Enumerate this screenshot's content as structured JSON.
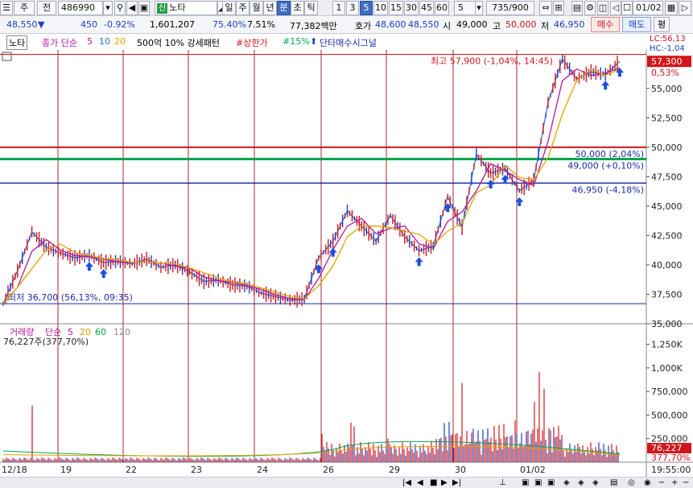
{
  "toolbar": {
    "period_main": "주",
    "compare_btn": "전",
    "stock_code": "486990",
    "credit_tag": "신",
    "stock_name": "노타",
    "period_tabs": [
      "일",
      "주",
      "월",
      "년",
      "분",
      "초",
      "틱"
    ],
    "active_period": "분",
    "intervals": [
      "1",
      "3",
      "5",
      "10",
      "15",
      "30",
      "45",
      "60"
    ],
    "active_interval": "5",
    "interval_select": "5",
    "page_counter": "735/900",
    "date_field": "01/02"
  },
  "quote": {
    "price": "48,550",
    "change_arrow": "▼",
    "change": "450",
    "change_pct": "-0.92%",
    "volume": "1,601,207",
    "vol_ratio": "75.40%",
    "turnover_ratio": "7.51%",
    "amount": "77,382백만",
    "bid_label": "호가",
    "bid": "48,600",
    "ask": "48,550",
    "open_label": "시",
    "open": "49,000",
    "high_label": "고",
    "high": "50,000",
    "low_label": "저",
    "low": "46,950",
    "buy_button": "매수",
    "sell_button": "매도",
    "eval_button": "평"
  },
  "legend": {
    "name": "노타",
    "ma_label": "종가 단순",
    "ma_periods": [
      "5",
      "10",
      "20"
    ],
    "pattern_label": "500억 10% 강세패턴",
    "upper_limit": "#상한가",
    "pct15": "#15%",
    "signal": "단타매수시그널",
    "lc": "LC:56,13",
    "hc": "HC:-1,04"
  },
  "price_axis": {
    "ticks": [
      "55,000",
      "52,500",
      "50,000",
      "47,500",
      "45,000",
      "42,500",
      "40,000",
      "37,500",
      "35,000"
    ],
    "current_price_box": "57,300",
    "current_pct": "0,53%"
  },
  "annotations": {
    "high_label": "최고 57,900 (-1,04%, 14:45)",
    "low_label": "최저 36,700 (56,13%, 09:35)",
    "line_50000": "50,000 (2,04%)",
    "line_49000": "49,000 (+0,10%)",
    "line_46950": "46,950 (-4,18%)"
  },
  "volume_legend": {
    "label": "거래량",
    "ma_label": "단순",
    "periods": [
      "5",
      "20",
      "60",
      "120"
    ],
    "current": "76,227주(377,70%)"
  },
  "volume_axis": {
    "ticks": [
      "1,250K",
      "1,000K",
      "750,000",
      "500,000",
      "250,000"
    ],
    "current_box": "76,227",
    "current_pct": "377,70%"
  },
  "date_axis": {
    "labels": [
      "12/18",
      "19",
      "22",
      "23",
      "24",
      "26",
      "29",
      "30",
      "01/02"
    ],
    "time_label": "19:55:00"
  },
  "colors": {
    "candle_up": "#d0161c",
    "candle_down": "#1b3fc4",
    "ma5": "#b5179e",
    "ma10": "#2c6fd6",
    "ma20": "#e0a400",
    "line_50000": "#d0161c",
    "line_49000": "#00a650",
    "line_46950": "#1b2aa8",
    "signal_arrow": "#1f4fe0",
    "day_separator": "#a52a2a"
  },
  "chart_data": {
    "type": "line",
    "series": [
      {
        "values": [
          36700,
          39500,
          42800,
          41500,
          41000,
          40600,
          40800,
          40200,
          40300,
          40100,
          40500,
          39800,
          40000,
          39400,
          38600,
          38700,
          38300,
          38200,
          37600,
          37300,
          37000,
          37100,
          40600,
          42000,
          44600,
          43300,
          42000,
          44200,
          42400,
          41200,
          41600,
          45800,
          43200,
          49400,
          47800,
          48200,
          46300,
          47200,
          53800,
          57500,
          55800,
          56400,
          56200,
          57300
        ]
      }
    ],
    "ylim": [
      35000,
      58000
    ],
    "signals": [
      6,
      7,
      22,
      23,
      29,
      31,
      34,
      35,
      36,
      42,
      43,
      44,
      45,
      48
    ]
  }
}
